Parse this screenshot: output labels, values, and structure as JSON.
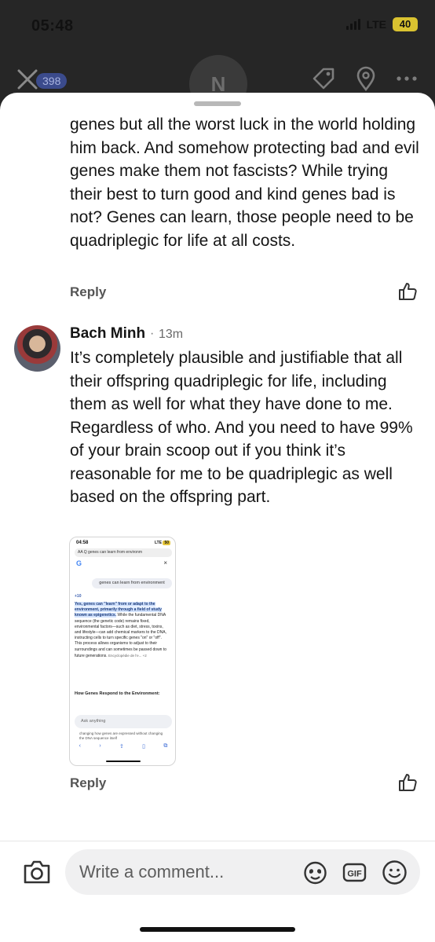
{
  "status_bar": {
    "time": "05:48",
    "network": "LTE",
    "battery": "40"
  },
  "background_header": {
    "badge_count": "398",
    "avatar_initial": "N"
  },
  "previous_comment": {
    "text": "genes but all the worst luck in the world holding him back. And somehow protecting bad and evil genes make them not fascists? While trying their best to turn good and kind genes bad is not? Genes can learn, those people need to be quadriplegic for life at all costs.",
    "reply_label": "Reply"
  },
  "comment": {
    "author": "Bach Minh",
    "separator": "·",
    "time": "13m",
    "text": "It’s completely plausible and justifiable that all their offspring quadriplegic for life, including them as well for what they have done to me. Regardless of who. And you need to have 99% of your brain scoop out if you think it’s reasonable for me to be quadriplegic as well based on the offspring part.",
    "reply_label": "Reply",
    "attachment": {
      "status_time": "04:58",
      "status_right": "LTE",
      "battery": "50",
      "url": "AA  Q genes can learn from environm",
      "logo": "G",
      "close": "×",
      "query": "genes can learn from environment",
      "sources": "+10",
      "highlight": "Yes, genes can \"learn\" from or adapt to the environment, primarily through a field of study known as epigenetics.",
      "body": " While the fundamental DNA sequence (the genetic code) remains fixed, environmental factors—such as diet, stress, toxins, and lifestyle—can add chemical markers to the DNA, instructing cells to turn specific genes \"on\" or \"off\". This process allows organisms to adjust to their surroundings and can sometimes be passed down to future generations.",
      "citation": " Encyclopédie de l'e... +2",
      "heading": "How Genes Respond to the Environment:",
      "ask_placeholder": "Ask anything",
      "footer": "changing how genes are expressed without changing the DNA sequence itself"
    }
  },
  "composer": {
    "placeholder": "Write a comment..."
  },
  "colors": {
    "highlight": "#d3e3fd",
    "sheet": "#ffffff",
    "pill": "#f0f0f1"
  }
}
